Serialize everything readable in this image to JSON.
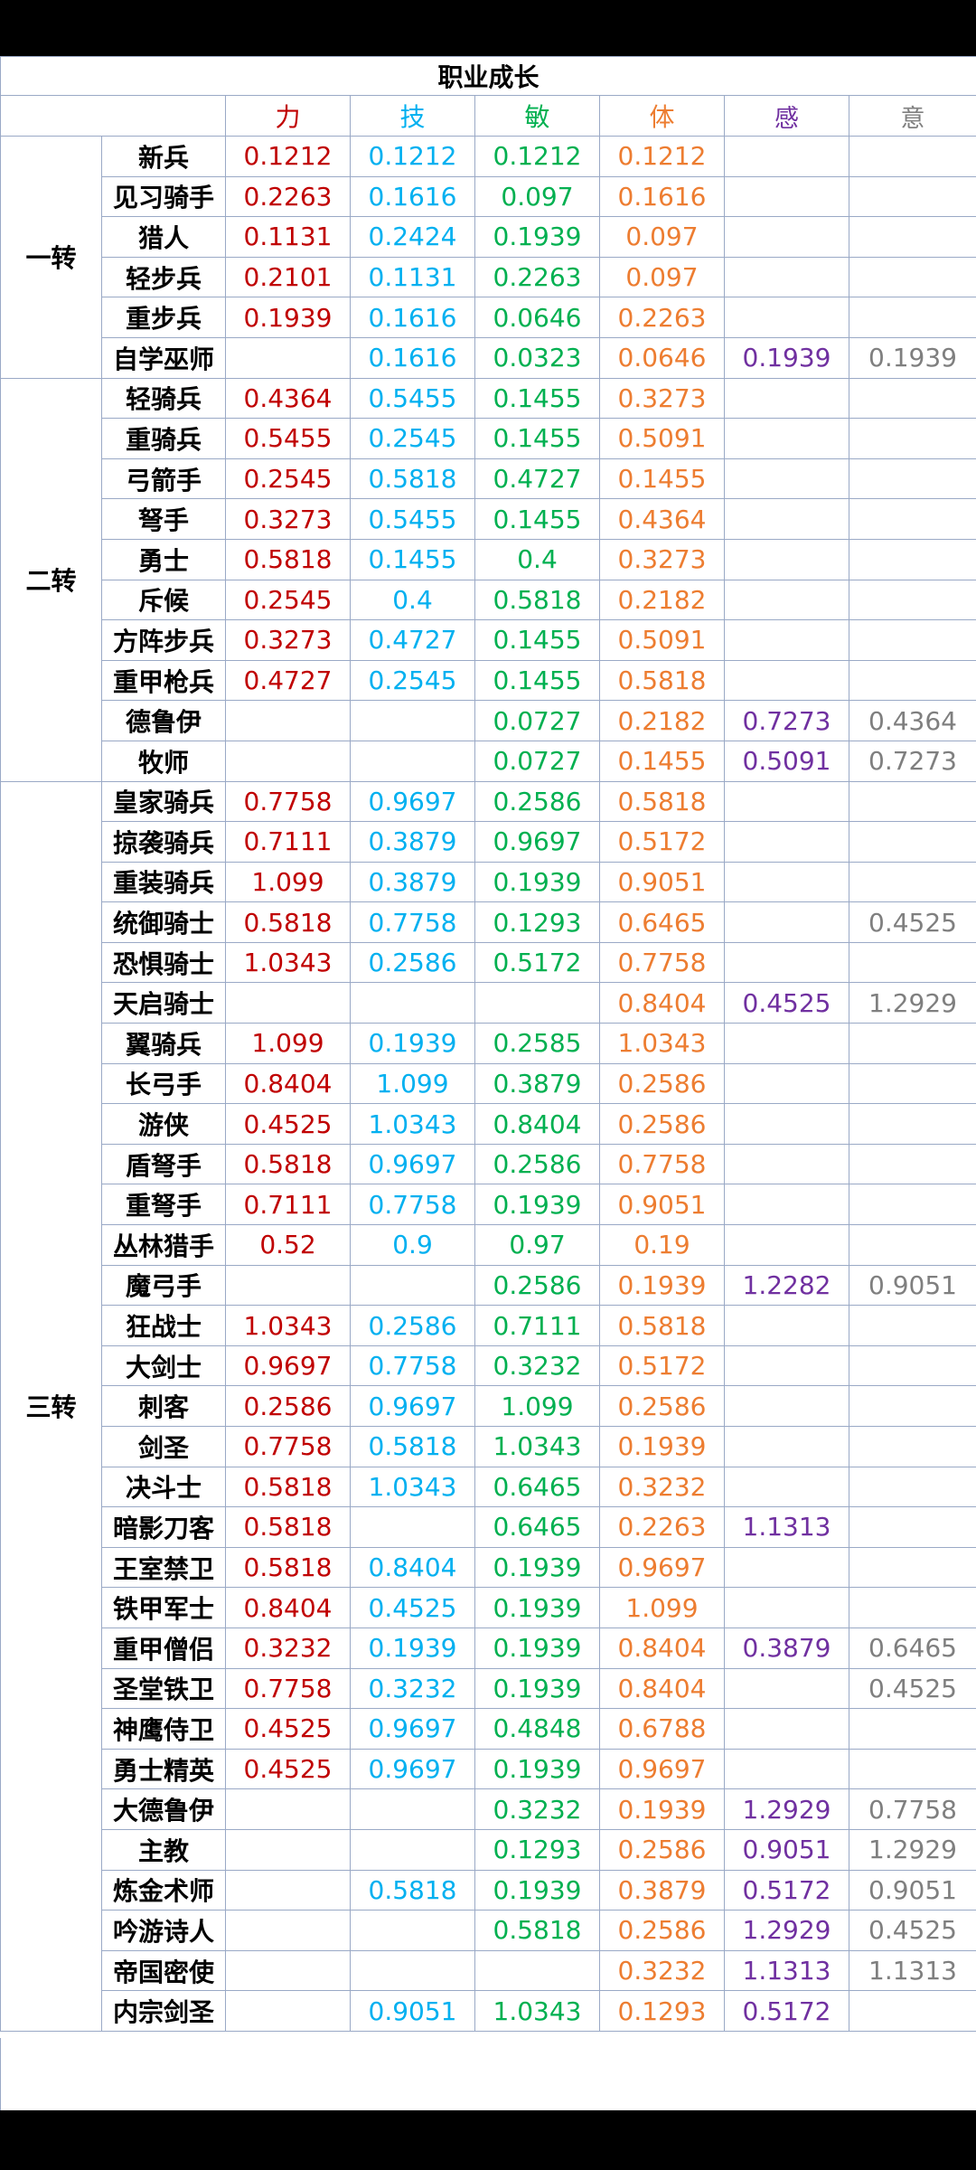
{
  "title": "职业成长",
  "columns": [
    {
      "key": "li",
      "label": "力",
      "color": "#c00000"
    },
    {
      "key": "ji",
      "label": "技",
      "color": "#00b0f0"
    },
    {
      "key": "min",
      "label": "敏",
      "color": "#00b050"
    },
    {
      "key": "ti",
      "label": "体",
      "color": "#ed7d31"
    },
    {
      "key": "gan",
      "label": "感",
      "color": "#7030a0"
    },
    {
      "key": "yi",
      "label": "意",
      "color": "#7f7f7f"
    }
  ],
  "tiers": [
    {
      "name": "一转",
      "rows": [
        {
          "name": "新兵",
          "li": "0.1212",
          "ji": "0.1212",
          "min": "0.1212",
          "ti": "0.1212",
          "gan": "",
          "yi": ""
        },
        {
          "name": "见习骑手",
          "li": "0.2263",
          "ji": "0.1616",
          "min": "0.097",
          "ti": "0.1616",
          "gan": "",
          "yi": ""
        },
        {
          "name": "猎人",
          "li": "0.1131",
          "ji": "0.2424",
          "min": "0.1939",
          "ti": "0.097",
          "gan": "",
          "yi": ""
        },
        {
          "name": "轻步兵",
          "li": "0.2101",
          "ji": "0.1131",
          "min": "0.2263",
          "ti": "0.097",
          "gan": "",
          "yi": ""
        },
        {
          "name": "重步兵",
          "li": "0.1939",
          "ji": "0.1616",
          "min": "0.0646",
          "ti": "0.2263",
          "gan": "",
          "yi": ""
        },
        {
          "name": "自学巫师",
          "li": "",
          "ji": "0.1616",
          "min": "0.0323",
          "ti": "0.0646",
          "gan": "0.1939",
          "yi": "0.1939"
        }
      ]
    },
    {
      "name": "二转",
      "rows": [
        {
          "name": "轻骑兵",
          "li": "0.4364",
          "ji": "0.5455",
          "min": "0.1455",
          "ti": "0.3273",
          "gan": "",
          "yi": ""
        },
        {
          "name": "重骑兵",
          "li": "0.5455",
          "ji": "0.2545",
          "min": "0.1455",
          "ti": "0.5091",
          "gan": "",
          "yi": ""
        },
        {
          "name": "弓箭手",
          "li": "0.2545",
          "ji": "0.5818",
          "min": "0.4727",
          "ti": "0.1455",
          "gan": "",
          "yi": ""
        },
        {
          "name": "弩手",
          "li": "0.3273",
          "ji": "0.5455",
          "min": "0.1455",
          "ti": "0.4364",
          "gan": "",
          "yi": ""
        },
        {
          "name": "勇士",
          "li": "0.5818",
          "ji": "0.1455",
          "min": "0.4",
          "ti": "0.3273",
          "gan": "",
          "yi": ""
        },
        {
          "name": "斥候",
          "li": "0.2545",
          "ji": "0.4",
          "min": "0.5818",
          "ti": "0.2182",
          "gan": "",
          "yi": ""
        },
        {
          "name": "方阵步兵",
          "li": "0.3273",
          "ji": "0.4727",
          "min": "0.1455",
          "ti": "0.5091",
          "gan": "",
          "yi": ""
        },
        {
          "name": "重甲枪兵",
          "li": "0.4727",
          "ji": "0.2545",
          "min": "0.1455",
          "ti": "0.5818",
          "gan": "",
          "yi": ""
        },
        {
          "name": "德鲁伊",
          "li": "",
          "ji": "",
          "min": "0.0727",
          "ti": "0.2182",
          "gan": "0.7273",
          "yi": "0.4364"
        },
        {
          "name": "牧师",
          "li": "",
          "ji": "",
          "min": "0.0727",
          "ti": "0.1455",
          "gan": "0.5091",
          "yi": "0.7273"
        }
      ]
    },
    {
      "name": "三转",
      "rows": [
        {
          "name": "皇家骑兵",
          "li": "0.7758",
          "ji": "0.9697",
          "min": "0.2586",
          "ti": "0.5818",
          "gan": "",
          "yi": ""
        },
        {
          "name": "掠袭骑兵",
          "li": "0.7111",
          "ji": "0.3879",
          "min": "0.9697",
          "ti": "0.5172",
          "gan": "",
          "yi": ""
        },
        {
          "name": "重装骑兵",
          "li": "1.099",
          "ji": "0.3879",
          "min": "0.1939",
          "ti": "0.9051",
          "gan": "",
          "yi": ""
        },
        {
          "name": "统御骑士",
          "li": "0.5818",
          "ji": "0.7758",
          "min": "0.1293",
          "ti": "0.6465",
          "gan": "",
          "yi": "0.4525"
        },
        {
          "name": "恐惧骑士",
          "li": "1.0343",
          "ji": "0.2586",
          "min": "0.5172",
          "ti": "0.7758",
          "gan": "",
          "yi": ""
        },
        {
          "name": "天启骑士",
          "li": "",
          "ji": "",
          "min": "",
          "ti": "0.8404",
          "gan": "0.4525",
          "yi": "1.2929"
        },
        {
          "name": "翼骑兵",
          "li": "1.099",
          "ji": "0.1939",
          "min": "0.2585",
          "ti": "1.0343",
          "gan": "",
          "yi": ""
        },
        {
          "name": "长弓手",
          "li": "0.8404",
          "ji": "1.099",
          "min": "0.3879",
          "ti": "0.2586",
          "gan": "",
          "yi": ""
        },
        {
          "name": "游侠",
          "li": "0.4525",
          "ji": "1.0343",
          "min": "0.8404",
          "ti": "0.2586",
          "gan": "",
          "yi": ""
        },
        {
          "name": "盾弩手",
          "li": "0.5818",
          "ji": "0.9697",
          "min": "0.2586",
          "ti": "0.7758",
          "gan": "",
          "yi": ""
        },
        {
          "name": "重弩手",
          "li": "0.7111",
          "ji": "0.7758",
          "min": "0.1939",
          "ti": "0.9051",
          "gan": "",
          "yi": ""
        },
        {
          "name": "丛林猎手",
          "li": "0.52",
          "ji": "0.9",
          "min": "0.97",
          "ti": "0.19",
          "gan": "",
          "yi": ""
        },
        {
          "name": "魔弓手",
          "li": "",
          "ji": "",
          "min": "0.2586",
          "ti": "0.1939",
          "gan": "1.2282",
          "yi": "0.9051"
        },
        {
          "name": "狂战士",
          "li": "1.0343",
          "ji": "0.2586",
          "min": "0.7111",
          "ti": "0.5818",
          "gan": "",
          "yi": ""
        },
        {
          "name": "大剑士",
          "li": "0.9697",
          "ji": "0.7758",
          "min": "0.3232",
          "ti": "0.5172",
          "gan": "",
          "yi": ""
        },
        {
          "name": "刺客",
          "li": "0.2586",
          "ji": "0.9697",
          "min": "1.099",
          "ti": "0.2586",
          "gan": "",
          "yi": ""
        },
        {
          "name": "剑圣",
          "li": "0.7758",
          "ji": "0.5818",
          "min": "1.0343",
          "ti": "0.1939",
          "gan": "",
          "yi": ""
        },
        {
          "name": "决斗士",
          "li": "0.5818",
          "ji": "1.0343",
          "min": "0.6465",
          "ti": "0.3232",
          "gan": "",
          "yi": ""
        },
        {
          "name": "暗影刀客",
          "li": "0.5818",
          "ji": "",
          "min": "0.6465",
          "ti": "0.2263",
          "gan": "1.1313",
          "yi": ""
        },
        {
          "name": "王室禁卫",
          "li": "0.5818",
          "ji": "0.8404",
          "min": "0.1939",
          "ti": "0.9697",
          "gan": "",
          "yi": ""
        },
        {
          "name": "铁甲军士",
          "li": "0.8404",
          "ji": "0.4525",
          "min": "0.1939",
          "ti": "1.099",
          "gan": "",
          "yi": ""
        },
        {
          "name": "重甲僧侣",
          "li": "0.3232",
          "ji": "0.1939",
          "min": "0.1939",
          "ti": "0.8404",
          "gan": "0.3879",
          "yi": "0.6465"
        },
        {
          "name": "圣堂铁卫",
          "li": "0.7758",
          "ji": "0.3232",
          "min": "0.1939",
          "ti": "0.8404",
          "gan": "",
          "yi": "0.4525"
        },
        {
          "name": "神鹰侍卫",
          "li": "0.4525",
          "ji": "0.9697",
          "min": "0.4848",
          "ti": "0.6788",
          "gan": "",
          "yi": ""
        },
        {
          "name": "勇士精英",
          "li": "0.4525",
          "ji": "0.9697",
          "min": "0.1939",
          "ti": "0.9697",
          "gan": "",
          "yi": ""
        },
        {
          "name": "大德鲁伊",
          "li": "",
          "ji": "",
          "min": "0.3232",
          "ti": "0.1939",
          "gan": "1.2929",
          "yi": "0.7758"
        },
        {
          "name": "主教",
          "li": "",
          "ji": "",
          "min": "0.1293",
          "ti": "0.2586",
          "gan": "0.9051",
          "yi": "1.2929"
        },
        {
          "name": "炼金术师",
          "li": "",
          "ji": "0.5818",
          "min": "0.1939",
          "ti": "0.3879",
          "gan": "0.5172",
          "yi": "0.9051"
        },
        {
          "name": "吟游诗人",
          "li": "",
          "ji": "",
          "min": "0.5818",
          "ti": "0.2586",
          "gan": "1.2929",
          "yi": "0.4525"
        },
        {
          "name": "帝国密使",
          "li": "",
          "ji": "",
          "min": "",
          "ti": "0.3232",
          "gan": "1.1313",
          "yi": "1.1313"
        },
        {
          "name": "内宗剑圣",
          "li": "",
          "ji": "0.9051",
          "min": "1.0343",
          "ti": "0.1293",
          "gan": "0.5172",
          "yi": ""
        }
      ]
    }
  ]
}
